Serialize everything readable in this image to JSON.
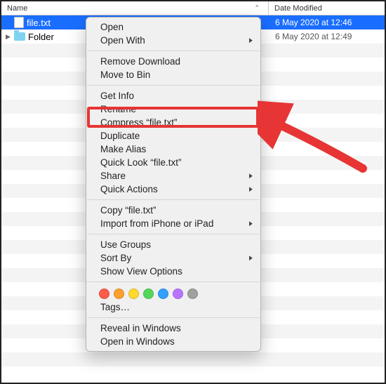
{
  "header": {
    "name_label": "Name",
    "date_label": "Date Modified"
  },
  "rows": [
    {
      "name": "file.txt",
      "date": "6 May 2020 at 12:46",
      "type": "file",
      "selected": true
    },
    {
      "name": "Folder",
      "date": "6 May 2020 at 12:49",
      "type": "folder",
      "selected": false
    }
  ],
  "menu": {
    "open": "Open",
    "open_with": "Open With",
    "remove_download": "Remove Download",
    "move_to_bin": "Move to Bin",
    "get_info": "Get Info",
    "rename": "Rename",
    "compress": "Compress “file.txt”",
    "duplicate": "Duplicate",
    "make_alias": "Make Alias",
    "quick_look": "Quick Look “file.txt”",
    "share": "Share",
    "quick_actions": "Quick Actions",
    "copy": "Copy “file.txt”",
    "import_ios": "Import from iPhone or iPad",
    "use_groups": "Use Groups",
    "sort_by": "Sort By",
    "show_view_options": "Show View Options",
    "tags": "Tags…",
    "reveal_in_windows": "Reveal in Windows",
    "open_in_windows": "Open in Windows"
  },
  "tag_colors": [
    "#ff5b4b",
    "#ff9f2e",
    "#ffd92e",
    "#54d65a",
    "#33a0ff",
    "#b974ff",
    "#a0a0a0"
  ]
}
